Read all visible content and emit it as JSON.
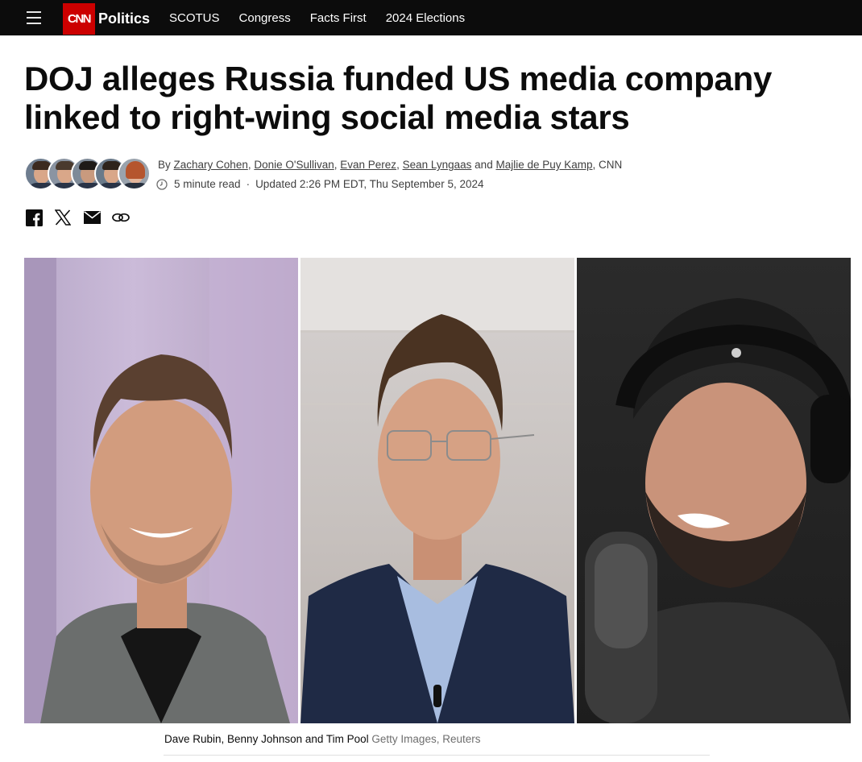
{
  "nav": {
    "logo_text": "CNN",
    "section": "Politics",
    "links": [
      "SCOTUS",
      "Congress",
      "Facts First",
      "2024 Elections"
    ],
    "brand_color": "#cc0000"
  },
  "article": {
    "headline": "DOJ alleges Russia funded US media company linked to right-wing social media stars",
    "byline": {
      "prefix": "By",
      "authors": [
        "Zachary Cohen",
        "Donie O'Sullivan",
        "Evan Perez",
        "Sean Lyngaas",
        "Majlie de Puy Kamp"
      ],
      "conjunction": "and",
      "outlet": "CNN"
    },
    "read_time": "5 minute read",
    "updated": "Updated 2:26 PM EDT, Thu September 5, 2024",
    "share_icons": [
      "facebook-icon",
      "x-icon",
      "email-icon",
      "link-icon"
    ],
    "image": {
      "caption": "Dave Rubin, Benny Johnson and Tim Pool",
      "credit": "Getty Images, Reuters"
    }
  }
}
